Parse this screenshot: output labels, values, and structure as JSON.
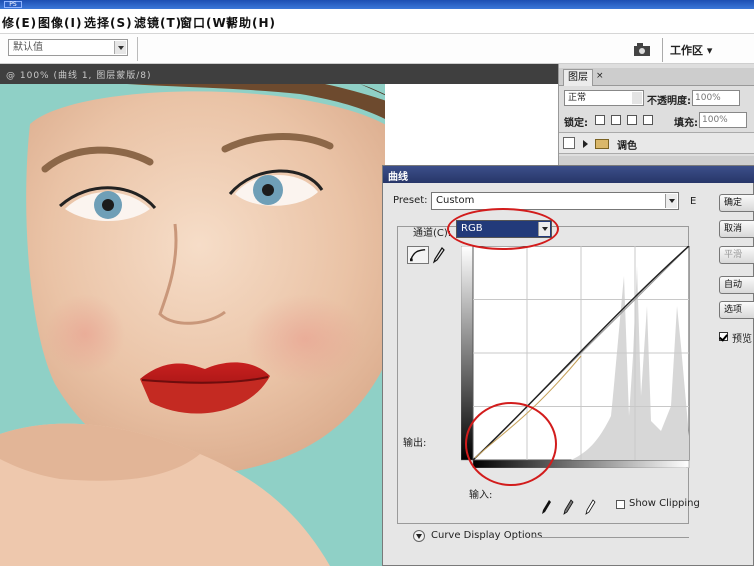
{
  "app": {
    "title_logo": "PS"
  },
  "menu": [
    "修(E)",
    "图像(I)",
    "选择(S)",
    "滤镜(T)",
    "窗口(W)",
    "帮助(H)"
  ],
  "options_bar": {
    "preset_value": "默认值",
    "workspace_label": "工作区 ▾"
  },
  "document": {
    "tab_title": "@ 100% (曲线 1, 图层蒙版/8)"
  },
  "layers_panel": {
    "tab_label": "图层",
    "tab_close": "×",
    "blend_mode": "正常",
    "opacity_label": "不透明度:",
    "opacity_value": "100%",
    "lock_label": "锁定:",
    "fill_label": "填充:",
    "fill_value": "100%",
    "layer_name": "调色"
  },
  "curves_dialog": {
    "title": "曲线",
    "preset_label": "Preset:",
    "preset_value": "Custom",
    "preset_options_glyph": "E",
    "channel_label": "通道(C):",
    "channel_value": "RGB",
    "output_label": "输出:",
    "input_label": "输入:",
    "show_clipping_label": "Show Clipping",
    "display_options_label": "Curve Display Options",
    "buttons": [
      "确定",
      "取消",
      "平滑",
      "自动",
      "选项",
      "预览"
    ],
    "preview_label": "预览",
    "preview_checked": true,
    "curve_points": [
      [
        0,
        0
      ],
      [
        255,
        255
      ]
    ]
  },
  "colors": {
    "annotation_red": "#d21c1c",
    "titlebar_blue": "#1d4fb3",
    "dialog_titlebar": "#273668",
    "canvas_background": "#8fd0c6"
  }
}
